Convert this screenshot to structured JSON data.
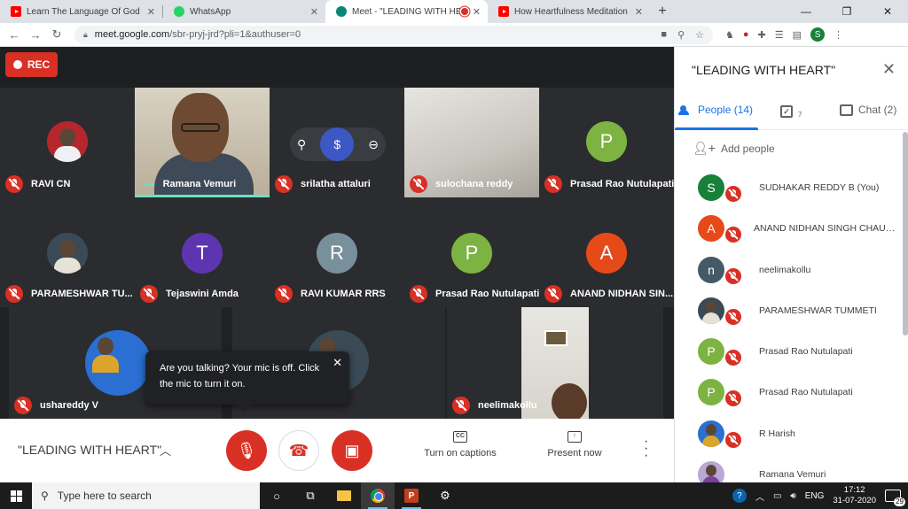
{
  "browser": {
    "tabs": [
      {
        "title": "Learn The Language Of God - Yo",
        "icon": "youtube-icon"
      },
      {
        "title": "WhatsApp",
        "icon": "whatsapp-icon"
      },
      {
        "title": "Meet - \"LEADING WITH HEA",
        "icon": "meet-icon",
        "active": true,
        "recording": true
      },
      {
        "title": "How Heartfulness Meditation Is T",
        "icon": "youtube-icon"
      }
    ],
    "new_tab": "+",
    "url_domain": "meet.google.com",
    "url_path": "/sbr-pryj-jrd?pli=1&authuser=0",
    "profile_initial": "S"
  },
  "meeting": {
    "rec_label": "REC",
    "title": "\"LEADING WITH HEART\"",
    "tiles": [
      {
        "name": "RAVI CN",
        "type": "photo",
        "photo": "red"
      },
      {
        "name": "Ramana Vemuri",
        "type": "video",
        "speaking": true
      },
      {
        "name": "srilatha attaluri",
        "type": "blank"
      },
      {
        "name": "sulochana reddy",
        "type": "video-sulochana"
      },
      {
        "name": "Prasad Rao Nutulapati",
        "type": "letter",
        "letter": "P",
        "color": "#7cb342"
      },
      {
        "name": "PARAMESHWAR TU...",
        "type": "photo",
        "photo": "dark"
      },
      {
        "name": "Tejaswini Amda",
        "type": "letter",
        "letter": "T",
        "color": "#5e35b1"
      },
      {
        "name": "RAVI KUMAR RRS",
        "type": "letter",
        "letter": "R",
        "color": "#78909c"
      },
      {
        "name": "Prasad Rao Nutulapati",
        "type": "letter",
        "letter": "P",
        "color": "#7cb342"
      },
      {
        "name": "ANAND NIDHAN SIN...",
        "type": "letter",
        "letter": "A",
        "color": "#e64a19"
      },
      {
        "name": "ushareddy V",
        "type": "photo",
        "photo": "blue"
      },
      {
        "name": "neelimakollu",
        "type": "video-neelima"
      }
    ],
    "tooltip": {
      "text": "Are you talking? Your mic is off. Click the mic to turn it on."
    },
    "controls": {
      "captions_label": "Turn on captions",
      "captions_icon": "CC",
      "present_label": "Present now"
    }
  },
  "panel": {
    "title": "\"LEADING WITH HEART\"",
    "tabs": {
      "people": "People (14)",
      "tasks_count": "7",
      "chat": "Chat (2)"
    },
    "add_people": "Add people",
    "people": [
      {
        "name": "SUDHAKAR REDDY B (You)",
        "avatar": "letter",
        "letter": "S",
        "color": "#188038"
      },
      {
        "name": "ANAND NIDHAN SINGH CHAUHAN",
        "avatar": "letter",
        "letter": "A",
        "color": "#e64a19"
      },
      {
        "name": "neelimakollu",
        "avatar": "letter",
        "letter": "n",
        "color": "#455a64"
      },
      {
        "name": "PARAMESHWAR TUMMETI",
        "avatar": "photo",
        "photo": "dark"
      },
      {
        "name": "Prasad Rao Nutulapati",
        "avatar": "letter",
        "letter": "P",
        "color": "#7cb342"
      },
      {
        "name": "Prasad Rao Nutulapati",
        "avatar": "letter",
        "letter": "P",
        "color": "#7cb342"
      },
      {
        "name": "R Harish",
        "avatar": "photo",
        "photo": "blue"
      },
      {
        "name": "Ramana Vemuri",
        "avatar": "photo",
        "photo": "purple"
      }
    ]
  },
  "taskbar": {
    "search_placeholder": "Type here to search",
    "tray_lang": "ENG",
    "time": "17:12",
    "date": "31-07-2020",
    "notification_count": "29"
  }
}
